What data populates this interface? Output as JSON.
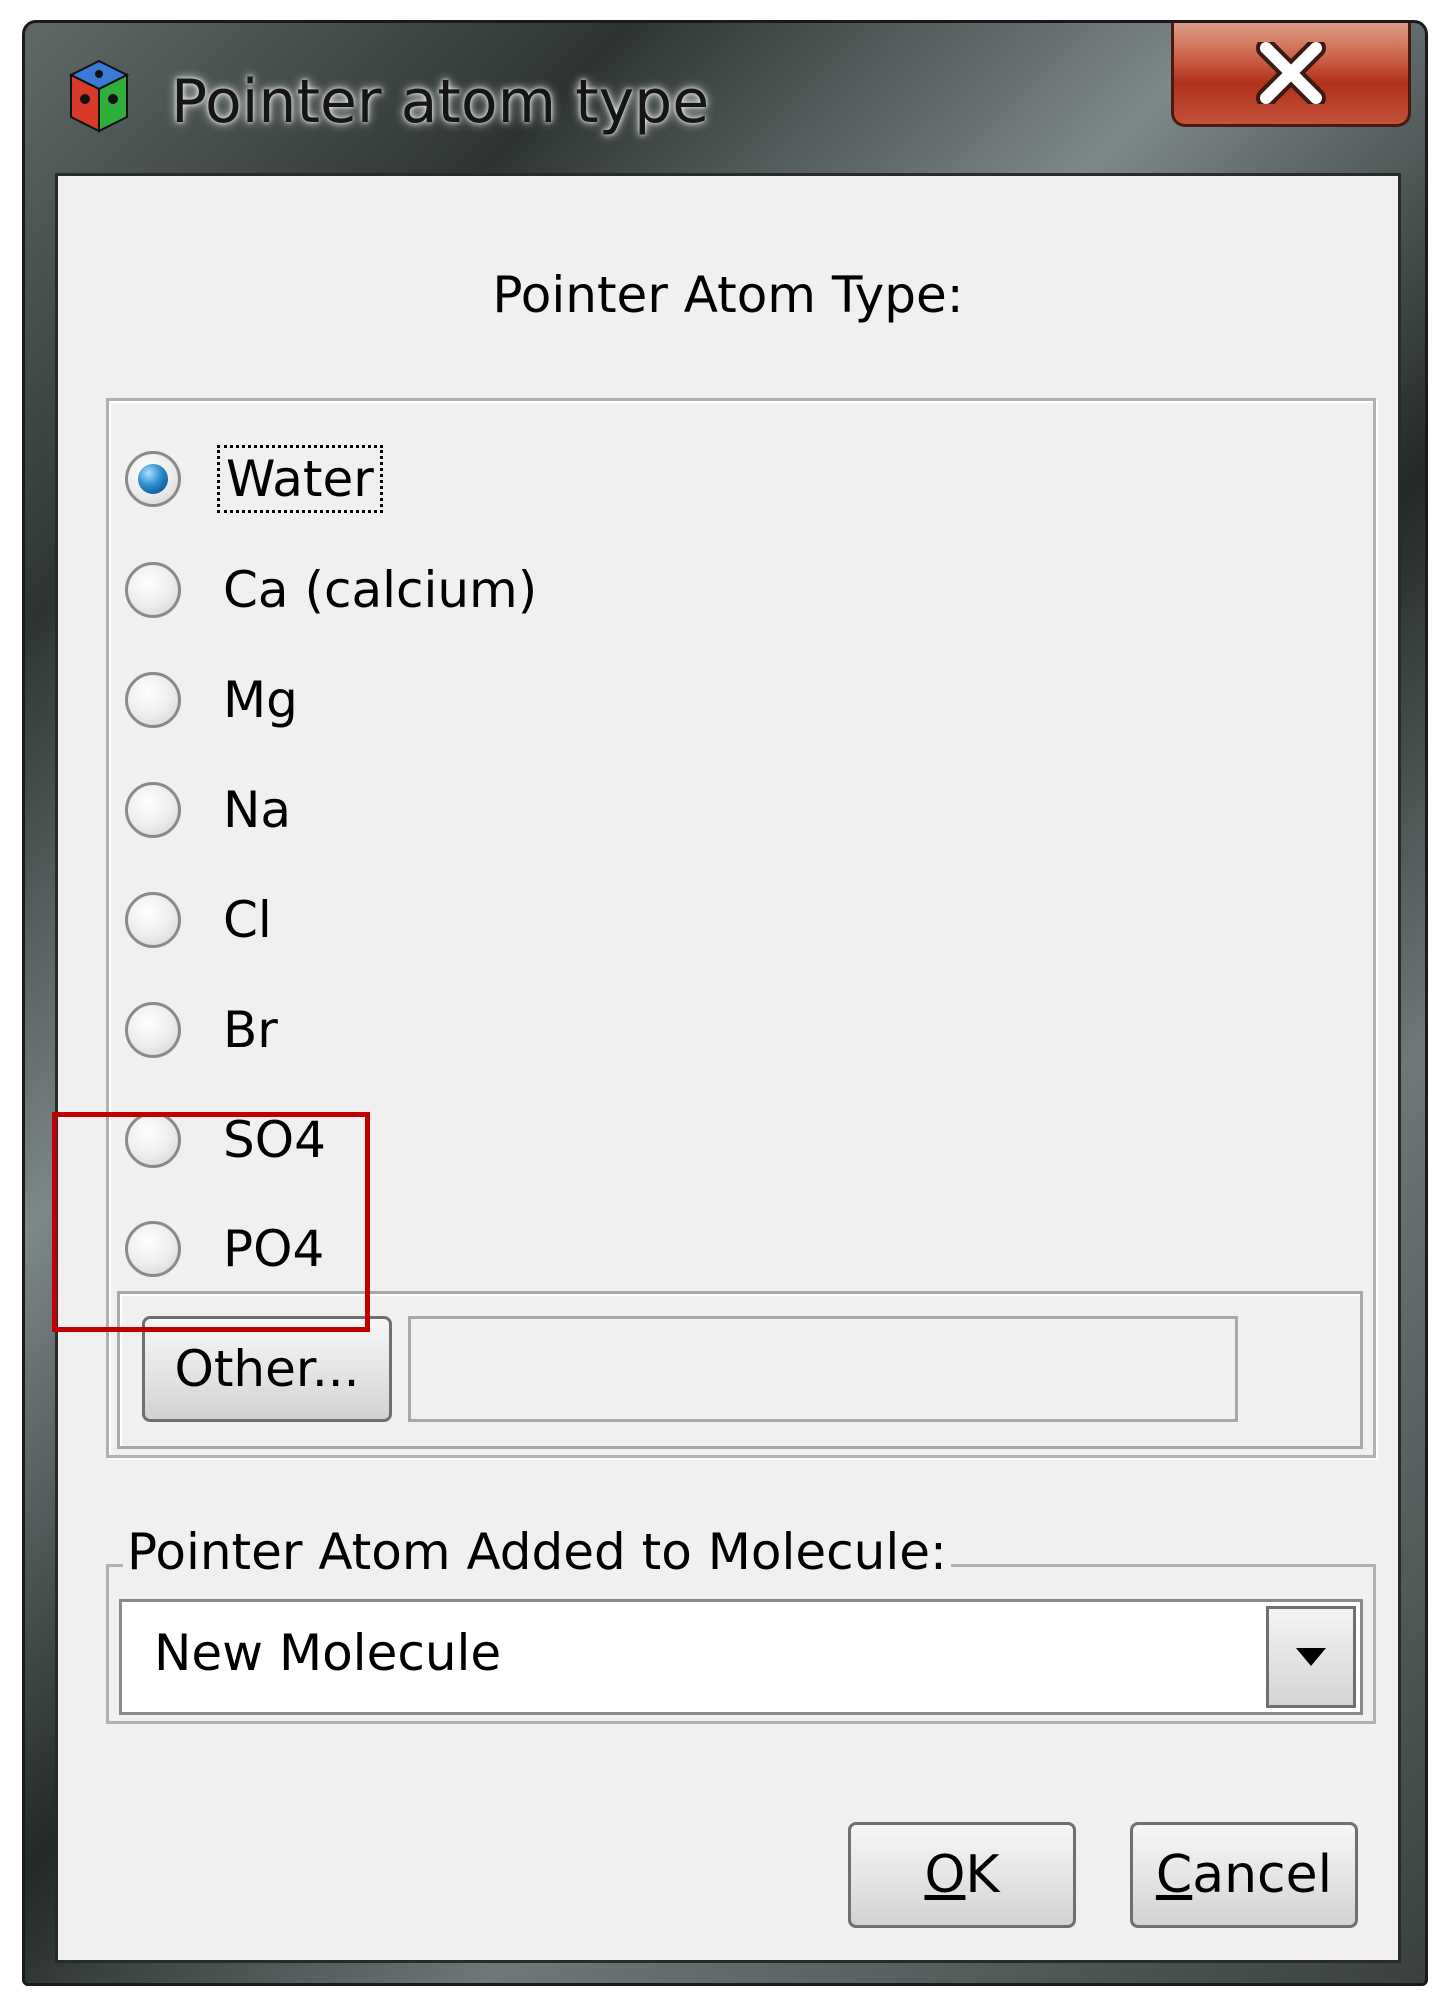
{
  "window": {
    "title": "Pointer atom type",
    "app_icon": "cube-app-icon",
    "close_icon": "close-icon"
  },
  "dialog": {
    "heading": "Pointer Atom Type:",
    "atom_types": [
      {
        "label": "Water",
        "selected": true
      },
      {
        "label": "Ca (calcium)",
        "selected": false
      },
      {
        "label": "Mg",
        "selected": false
      },
      {
        "label": "Na",
        "selected": false
      },
      {
        "label": "Cl",
        "selected": false
      },
      {
        "label": "Br",
        "selected": false
      },
      {
        "label": "SO4",
        "selected": false
      },
      {
        "label": "PO4",
        "selected": false
      }
    ],
    "other_button": "Other...",
    "other_value": "",
    "molecule_group_label": "Pointer Atom Added to Molecule:",
    "molecule_selected": "New Molecule",
    "ok": {
      "mnemonic": "O",
      "rest": "K"
    },
    "cancel": {
      "mnemonic": "C",
      "rest": "ancel"
    }
  },
  "annotation": {
    "color": "#c00000"
  }
}
